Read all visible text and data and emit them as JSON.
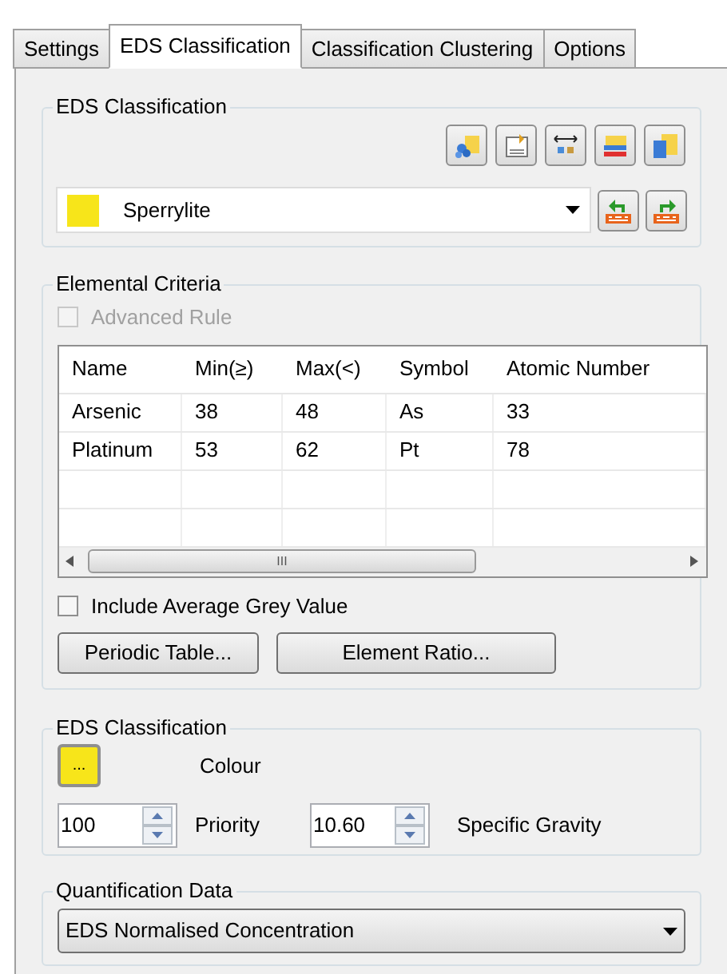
{
  "tabs": [
    {
      "label": "Settings",
      "selected": false
    },
    {
      "label": "EDS Classification",
      "selected": true
    },
    {
      "label": "Classification Clustering",
      "selected": false
    },
    {
      "label": "Options",
      "selected": false
    }
  ],
  "classification": {
    "title": "EDS Classification",
    "mineral": {
      "value": "Sperrylite",
      "color": "#f7e51a"
    }
  },
  "elemental_criteria": {
    "title": "Elemental Criteria",
    "advanced_rule": {
      "label": "Advanced Rule",
      "checked": false,
      "disabled": true
    },
    "table": {
      "columns": [
        "Name",
        "Min(≥)",
        "Max(<)",
        "Symbol",
        "Atomic Number"
      ],
      "rows": [
        [
          "Arsenic",
          "38",
          "48",
          "As",
          "33"
        ],
        [
          "Platinum",
          "53",
          "62",
          "Pt",
          "78"
        ]
      ]
    },
    "scroll_thumb": "III",
    "include_grey": {
      "label": "Include Average Grey Value",
      "checked": false,
      "disabled": false
    },
    "buttons": [
      "Periodic Table...",
      "Element Ratio..."
    ]
  },
  "eds_settings": {
    "title": "EDS Classification",
    "colour_button": {
      "label": "...",
      "color": "#f7e51a"
    },
    "colour_label": "Colour",
    "priority": {
      "value": "100",
      "label": "Priority"
    },
    "gravity": {
      "value": "10.60",
      "label": "Specific Gravity"
    }
  },
  "quantification": {
    "title": "Quantification Data",
    "value": "EDS Normalised Concentration"
  }
}
